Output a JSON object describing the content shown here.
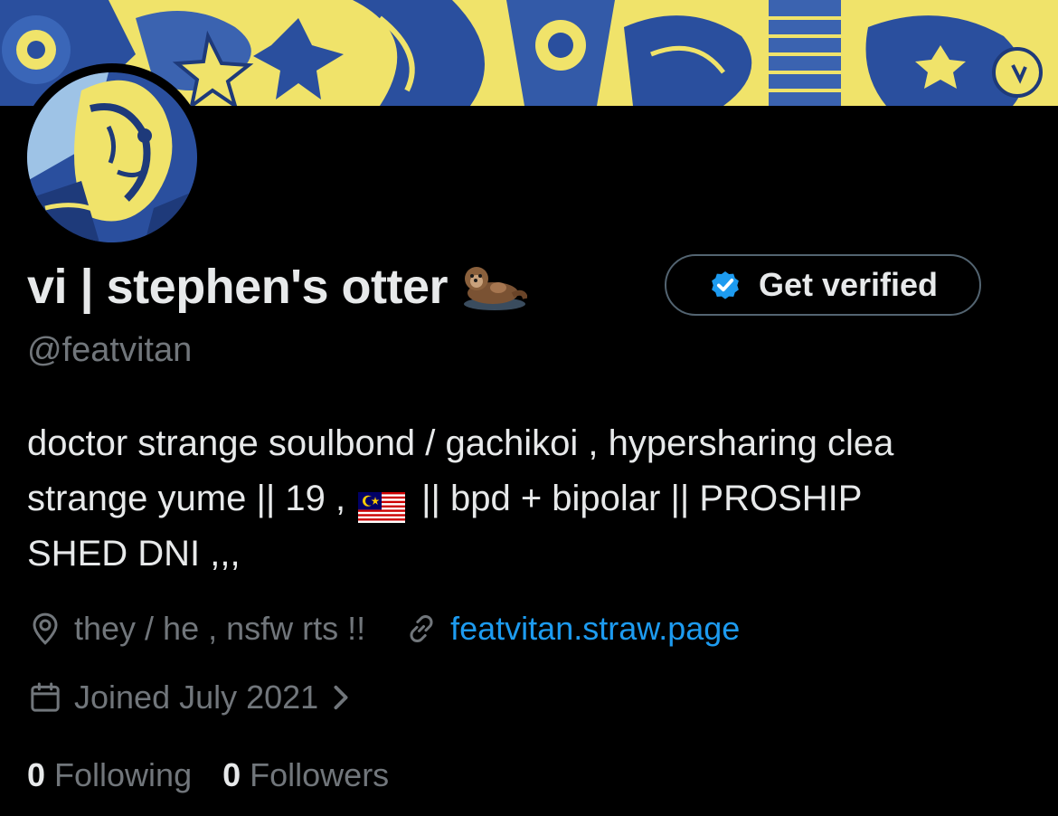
{
  "profile": {
    "display_name": "vi | stephen's otter",
    "name_emoji": "otter-icon",
    "handle": "@featvitan",
    "get_verified_label": "Get verified",
    "bio": {
      "line1": "doctor strange soulbond / gachikoi , hypersharing clea",
      "line2_before_flag": "strange yume || 19 ,",
      "line2_flag": "malaysia-flag-icon",
      "line2_after_flag": "|| bpd + bipolar || PROSHIP",
      "line3": "SHED DNI ,,,"
    },
    "location": "they / he , nsfw rts !!",
    "website": "featvitan.straw.page",
    "joined": "Joined July 2021",
    "following_count": "0",
    "following_label": "Following",
    "followers_count": "0",
    "followers_label": "Followers"
  },
  "colors": {
    "background": "#000000",
    "primary_text": "#e7e9ea",
    "secondary_text": "#71767b",
    "link": "#1d9bf0",
    "verified_badge": "#1d9bf0",
    "banner_blue": "#2a4f9e",
    "banner_yellow": "#f0e36a"
  },
  "icons": {
    "location": "location-pin-icon",
    "website": "link-icon",
    "joined": "calendar-icon",
    "joined_chevron": "chevron-right-icon",
    "verified": "verified-badge-icon"
  }
}
